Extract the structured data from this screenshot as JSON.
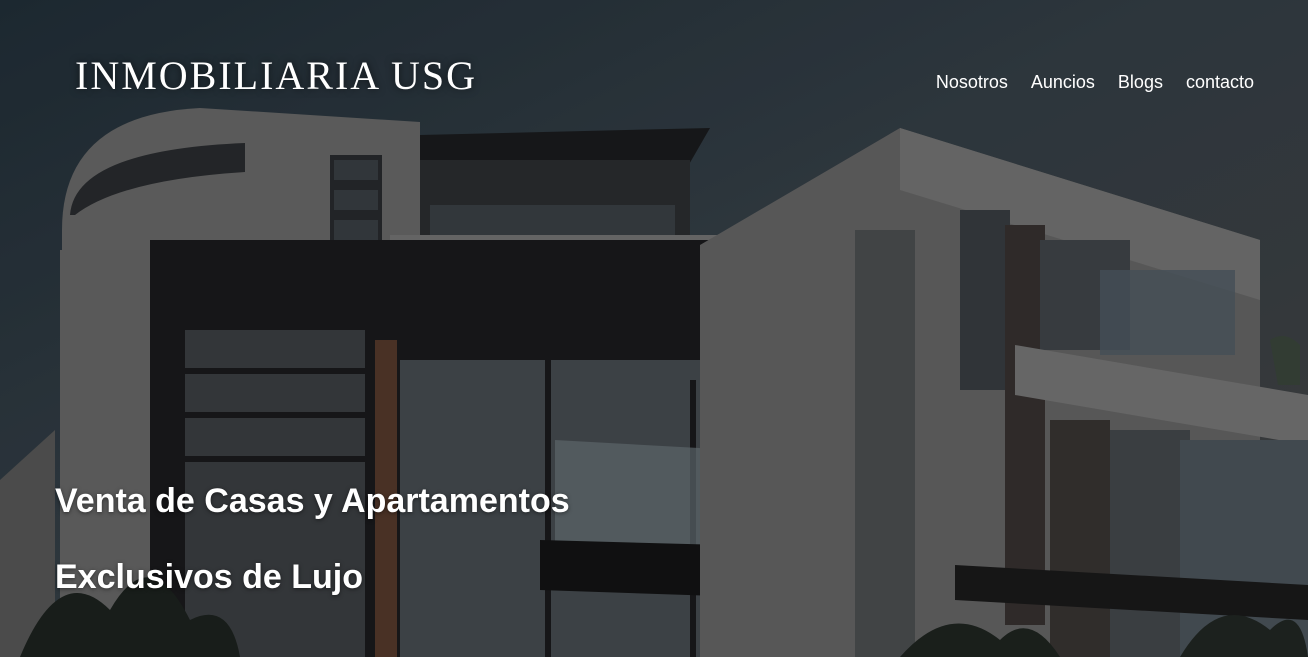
{
  "brand": {
    "logo_text": "INMOBILIARIA USG"
  },
  "nav": {
    "items": [
      {
        "label": "Nosotros"
      },
      {
        "label": "Auncios"
      },
      {
        "label": "Blogs"
      },
      {
        "label": "contacto"
      }
    ]
  },
  "hero": {
    "headline_line1": "Venta de Casas y Apartamentos",
    "headline_line2": "Exclusivos de Lujo"
  }
}
